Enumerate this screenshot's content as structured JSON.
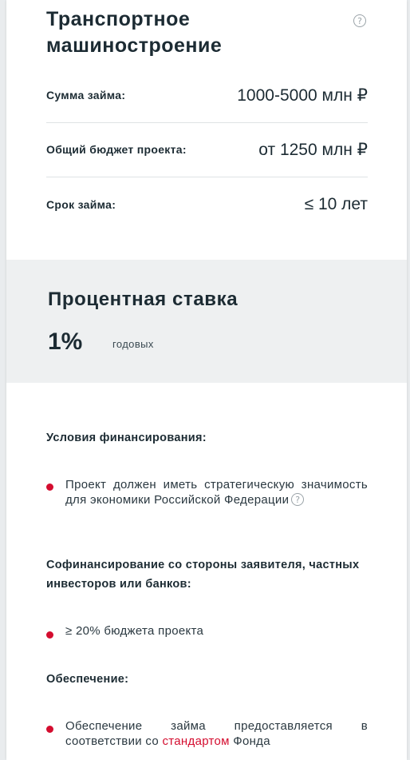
{
  "header": {
    "title": "Транспортное машиностроение"
  },
  "loan_params": [
    {
      "label": "Сумма займа:",
      "value": "1000-5000 млн ₽"
    },
    {
      "label": "Общий бюджет проекта:",
      "value": "от 1250 млн ₽"
    },
    {
      "label": "Срок займа:",
      "value": "≤ 10 лет"
    }
  ],
  "rate": {
    "title": "Процентная ставка",
    "value": "1%",
    "unit": "годовых"
  },
  "conditions": {
    "heading": "Условия финансирования:",
    "item": "Проект должен иметь стратегическую значимость для экономики Российской Федерации"
  },
  "cofinancing": {
    "heading": "Софинансирование со стороны заявителя, частных инвесторов или банков:",
    "item": "≥ 20% бюджета проекта"
  },
  "security": {
    "heading": "Обеспечение:",
    "item_prefix": "Обеспечение займа предоставляется в соответствии со",
    "item_link": "стандартом",
    "item_suffix": "Фонда"
  },
  "colors": {
    "accent": "#d40d2f",
    "text": "#1c2b33",
    "rate_background": "#eef0f1"
  }
}
